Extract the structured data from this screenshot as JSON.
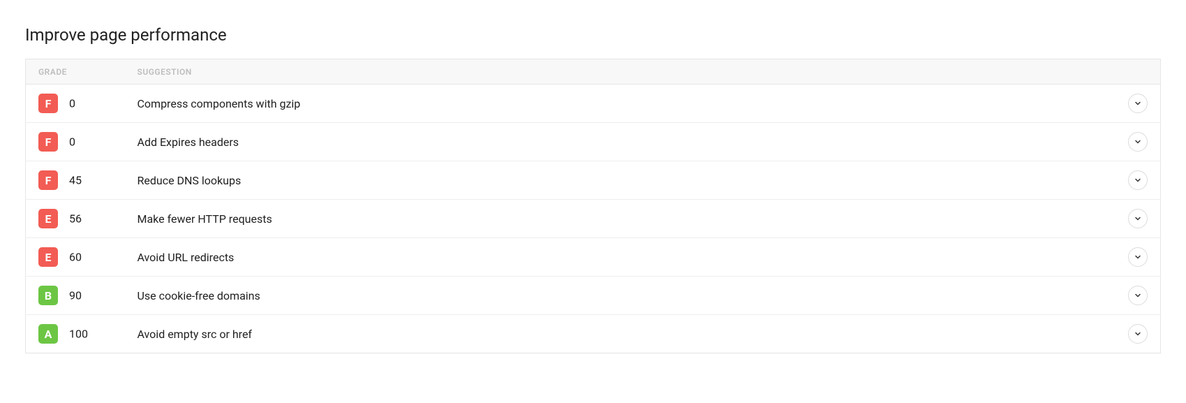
{
  "title": "Improve page performance",
  "columns": {
    "grade": "GRADE",
    "suggestion": "SUGGESTION"
  },
  "grade_colors": {
    "A": "#6cc644",
    "B": "#6cc644",
    "E": "#f25c54",
    "F": "#f25c54"
  },
  "rows": [
    {
      "grade": "F",
      "score": "0",
      "suggestion": "Compress components with gzip"
    },
    {
      "grade": "F",
      "score": "0",
      "suggestion": "Add Expires headers"
    },
    {
      "grade": "F",
      "score": "45",
      "suggestion": "Reduce DNS lookups"
    },
    {
      "grade": "E",
      "score": "56",
      "suggestion": "Make fewer HTTP requests"
    },
    {
      "grade": "E",
      "score": "60",
      "suggestion": "Avoid URL redirects"
    },
    {
      "grade": "B",
      "score": "90",
      "suggestion": "Use cookie-free domains"
    },
    {
      "grade": "A",
      "score": "100",
      "suggestion": "Avoid empty src or href"
    }
  ]
}
